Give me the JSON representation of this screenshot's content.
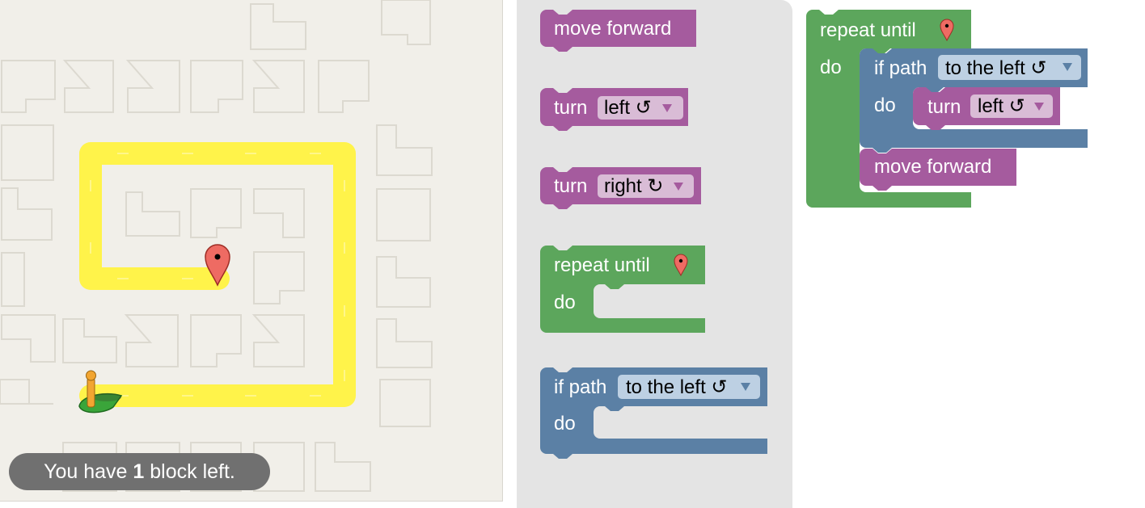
{
  "maze": {
    "counter": {
      "prefix": "You have ",
      "count": "1",
      "suffix": " block left."
    }
  },
  "colors": {
    "motion": "#a55b9e",
    "motion_field": "#d9bcd6",
    "motion_arrow": "#a55b9e",
    "loop": "#5ca65c",
    "logic": "#5b80a5",
    "logic_field": "#bdd0e3",
    "logic_arrow": "#5b80a5",
    "path": "#fff34a",
    "marker": "#ee6b63"
  },
  "toolbox": {
    "move_forward": "move forward",
    "turn_left": {
      "label": "turn",
      "field": "left ↺"
    },
    "turn_right": {
      "label": "turn",
      "field": "right ↻"
    },
    "repeat_until": {
      "label": "repeat until",
      "do": "do"
    },
    "if_path": {
      "label": "if path",
      "field": "to the left ↺",
      "do": "do"
    }
  },
  "workspace": {
    "repeat_until": {
      "label": "repeat until",
      "do": "do"
    },
    "if_path": {
      "label": "if path",
      "field": "to the left ↺",
      "do": "do"
    },
    "turn_left": {
      "label": "turn",
      "field": "left ↺"
    },
    "move_forward": "move forward"
  }
}
